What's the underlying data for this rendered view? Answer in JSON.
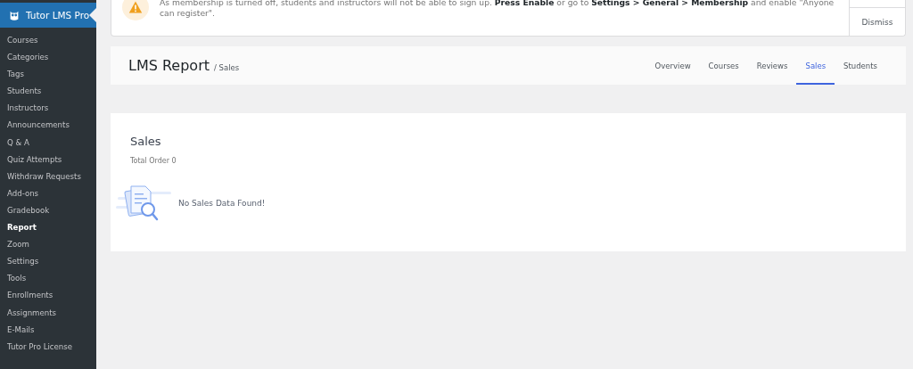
{
  "sidebar": {
    "title": "Tutor LMS Pro",
    "items": [
      {
        "label": "Courses",
        "selected": false
      },
      {
        "label": "Categories",
        "selected": false
      },
      {
        "label": "Tags",
        "selected": false
      },
      {
        "label": "Students",
        "selected": false
      },
      {
        "label": "Instructors",
        "selected": false
      },
      {
        "label": "Announcements",
        "selected": false
      },
      {
        "label": "Q & A",
        "selected": false
      },
      {
        "label": "Quiz Attempts",
        "selected": false
      },
      {
        "label": "Withdraw Requests",
        "selected": false
      },
      {
        "label": "Add-ons",
        "selected": false
      },
      {
        "label": "Gradebook",
        "selected": false
      },
      {
        "label": "Report",
        "selected": true
      },
      {
        "label": "Zoom",
        "selected": false
      },
      {
        "label": "Settings",
        "selected": false
      },
      {
        "label": "Tools",
        "selected": false
      },
      {
        "label": "Enrollments",
        "selected": false
      },
      {
        "label": "Assignments",
        "selected": false
      },
      {
        "label": "E-Mails",
        "selected": false
      },
      {
        "label": "Tutor Pro License",
        "selected": false
      }
    ]
  },
  "notice": {
    "message": "As membership is turned off, students and instructors will not be able to sign up. **Press Enable** or go to **Settings > General > Membership** and enable \"Anyone can register\".",
    "dismiss": "Dismiss"
  },
  "header": {
    "title": "LMS Report",
    "subtitle": "/ Sales",
    "tabs": [
      {
        "label": "Overview",
        "selected": false
      },
      {
        "label": "Courses",
        "selected": false
      },
      {
        "label": "Reviews",
        "selected": false
      },
      {
        "label": "Sales",
        "selected": true
      },
      {
        "label": "Students",
        "selected": false
      }
    ]
  },
  "sales": {
    "title": "Sales",
    "total": "Total Order 0",
    "empty": "No Sales Data Found!"
  }
}
